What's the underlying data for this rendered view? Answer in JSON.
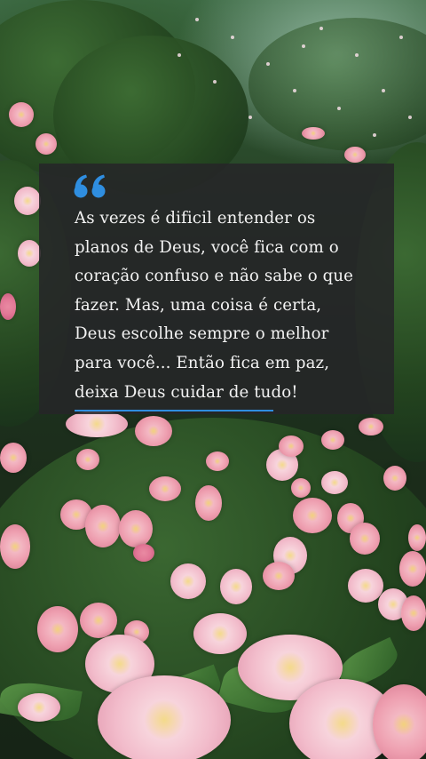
{
  "quote": {
    "icon": "quote-mark-icon",
    "accent_color": "#2f8ee0",
    "text": "As vezes é dificil entender os\nplanos de Deus, você fica com o\ncoração confuso e não sabe o que\nfazer. Mas, uma coisa é certa,\nDeus escolhe sempre o melhor\npara você... Então fica em paz,\ndeixa Deus cuidar de tudo!"
  },
  "background": {
    "description_icon": "rose-garden-background"
  }
}
